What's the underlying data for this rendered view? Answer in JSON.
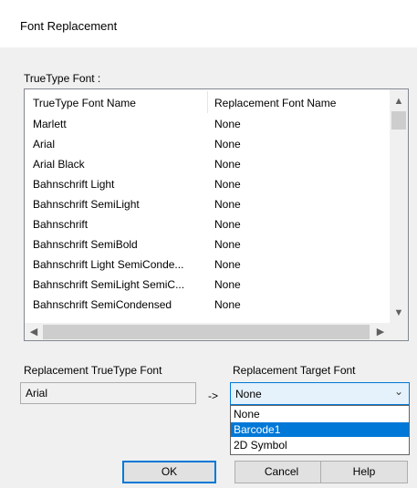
{
  "window": {
    "title": "Font Replacement"
  },
  "truetype_group": {
    "label": "TrueType Font :",
    "columns": [
      "TrueType Font Name",
      "Replacement Font Name"
    ],
    "rows": [
      [
        "Marlett",
        "None"
      ],
      [
        "Arial",
        "None"
      ],
      [
        "Arial Black",
        "None"
      ],
      [
        "Bahnschrift Light",
        "None"
      ],
      [
        "Bahnschrift SemiLight",
        "None"
      ],
      [
        "Bahnschrift",
        "None"
      ],
      [
        "Bahnschrift SemiBold",
        "None"
      ],
      [
        "Bahnschrift Light SemiConde...",
        "None"
      ],
      [
        "Bahnschrift SemiLight SemiC...",
        "None"
      ],
      [
        "Bahnschrift SemiCondensed",
        "None"
      ]
    ],
    "icons": {
      "scroll_up": "▲",
      "scroll_down": "▼",
      "scroll_left": "◀",
      "scroll_right": "▶"
    }
  },
  "replacement": {
    "tt_label": "Replacement TrueType Font",
    "tt_value": "Arial",
    "arrow": "->",
    "target_label": "Replacement Target Font",
    "target_value": "None",
    "chevron": "⌄",
    "options": [
      "None",
      "Barcode1",
      "2D Symbol"
    ],
    "selected_option": "Barcode1"
  },
  "buttons": {
    "ok": "OK",
    "cancel": "Cancel",
    "help": "Help"
  },
  "colors": {
    "accent": "#0078d7",
    "dialog_bg": "#f0f0f0",
    "selection_text": "#ffffff"
  }
}
